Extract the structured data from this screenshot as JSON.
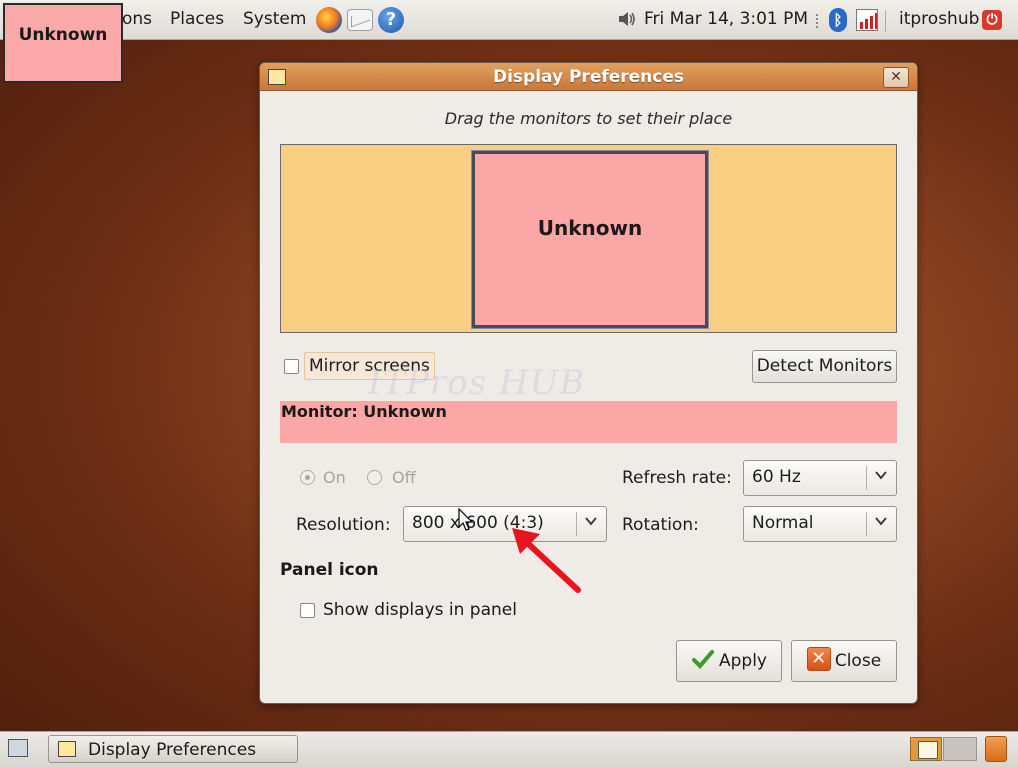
{
  "top_panel": {
    "menus": [
      "ons",
      "Places",
      "System"
    ],
    "clock": "Fri Mar 14,  3:01 PM",
    "user": "itproshub",
    "icons": [
      "firefox-icon",
      "mail-icon",
      "help-icon",
      "volume-icon",
      "bluetooth-icon",
      "network-icon",
      "power-icon"
    ]
  },
  "overlay_label": "Unknown",
  "dialog": {
    "title": "Display Preferences",
    "close_glyph": "✕",
    "drag_hint": "Drag the monitors to set their place",
    "monitor_box_label": "Unknown",
    "mirror_screens": {
      "label": "Mirror screens",
      "checked": false
    },
    "detect_button": "Detect Monitors",
    "monitor_heading": "Monitor: Unknown",
    "power": {
      "on_label": "On",
      "off_label": "Off",
      "selected": "On",
      "enabled": false
    },
    "resolution": {
      "label": "Resolution:",
      "value": "800 x 600 (4:3)"
    },
    "refresh_rate": {
      "label": "Refresh rate:",
      "value": "60 Hz"
    },
    "rotation": {
      "label": "Rotation:",
      "value": "Normal"
    },
    "panel_icon_heading": "Panel icon",
    "show_displays": {
      "label": "Show displays in panel",
      "checked": false
    },
    "apply_button": "Apply",
    "close_button": "Close"
  },
  "watermark": "ITPros HUB",
  "bottom_panel": {
    "taskbar_item": "Display Preferences"
  },
  "colors": {
    "monitor_area": "#f9cf84",
    "monitor_fill": "#fba7a5",
    "titlebar": "#c9773a",
    "annotation_arrow": "#e8141e"
  }
}
